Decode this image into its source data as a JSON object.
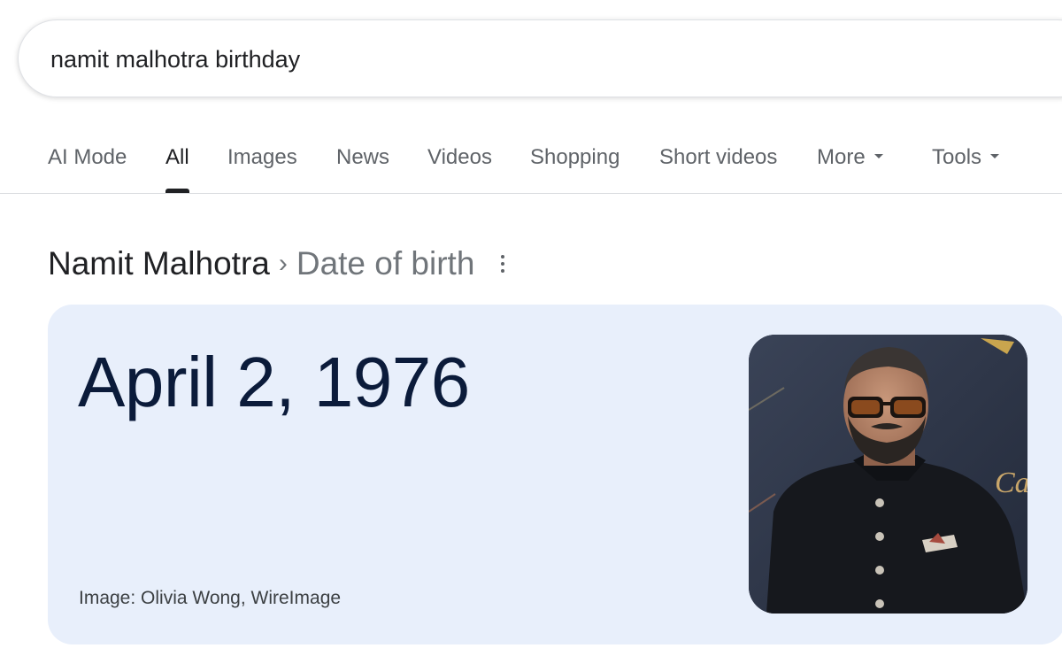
{
  "search": {
    "query": "namit malhotra birthday"
  },
  "tabs": [
    {
      "label": "AI Mode"
    },
    {
      "label": "All"
    },
    {
      "label": "Images"
    },
    {
      "label": "News"
    },
    {
      "label": "Videos"
    },
    {
      "label": "Shopping"
    },
    {
      "label": "Short videos"
    },
    {
      "label": "More"
    },
    {
      "label": "Tools"
    }
  ],
  "active_tab": "All",
  "result": {
    "entity": "Namit Malhotra",
    "separator": "›",
    "attribute": "Date of birth",
    "answer": "April 2, 1976",
    "image_credit": "Image: Olivia Wong, WireImage",
    "photo_backdrop_text": "Ca"
  },
  "icons": {
    "more_options": "more-vert-icon",
    "dropdown": "chevron-down-icon"
  },
  "colors": {
    "card_background": "#e8effb",
    "answer_text": "#0b1b3a",
    "tab_inactive": "#5f6368",
    "tab_active": "#202124"
  }
}
